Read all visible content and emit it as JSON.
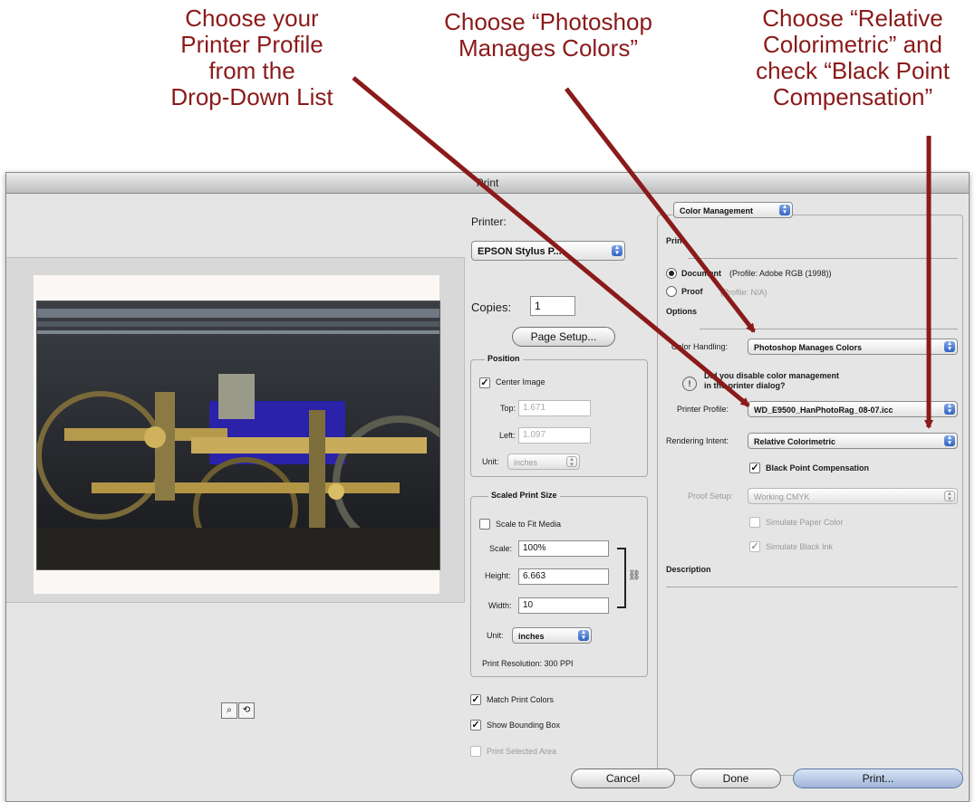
{
  "annotations": {
    "profile": [
      "Choose your",
      "Printer Profile",
      "from the",
      "Drop-Down List"
    ],
    "manages": [
      "Choose “Photoshop",
      "Manages Colors”"
    ],
    "intent": [
      "Choose “Relative",
      "Colorimetric” and",
      "check “Black Point",
      "Compensation”"
    ],
    "color": "#8b1a1a"
  },
  "dialog": {
    "title": "Print",
    "printer_label": "Printer:",
    "printer_value": "EPSON Stylus P...",
    "copies_label": "Copies:",
    "copies_value": "1",
    "page_setup_label": "Page Setup...",
    "position": {
      "title": "Position",
      "center_image": "Center Image",
      "top_label": "Top:",
      "top_value": "1.671",
      "left_label": "Left:",
      "left_value": "1.097",
      "unit_label": "Unit:",
      "unit_value": "inches"
    },
    "scaled": {
      "title": "Scaled Print Size",
      "scale_to_fit": "Scale to Fit Media",
      "scale_label": "Scale:",
      "scale_value": "100%",
      "height_label": "Height:",
      "height_value": "6.663",
      "width_label": "Width:",
      "width_value": "10",
      "unit_label": "Unit:",
      "unit_value": "inches",
      "resolution": "Print Resolution: 300 PPI"
    },
    "match_print_colors": "Match Print Colors",
    "show_bounding_box": "Show Bounding Box",
    "print_selected_area": "Print Selected Area",
    "color_management": {
      "popup": "Color Management",
      "print_label": "Print",
      "document_label": "Document",
      "document_profile": "(Profile: Adobe RGB (1998))",
      "proof_label": "Proof",
      "proof_profile": "(Profile: N/A)",
      "options_label": "Options",
      "color_handling_label": "Color Handling:",
      "color_handling_value": "Photoshop Manages Colors",
      "warning_text": [
        "Did you disable color management",
        "in the printer dialog?"
      ],
      "printer_profile_label": "Printer Profile:",
      "printer_profile_value": "WD_E9500_HanPhotoRag_08-07.icc",
      "rendering_intent_label": "Rendering Intent:",
      "rendering_intent_value": "Relative Colorimetric",
      "black_point": "Black Point Compensation",
      "proof_setup_label": "Proof Setup:",
      "proof_setup_value": "Working CMYK",
      "simulate_paper": "Simulate Paper Color",
      "simulate_black": "Simulate Black Ink",
      "description_label": "Description"
    },
    "buttons": {
      "cancel": "Cancel",
      "done": "Done",
      "print": "Print..."
    }
  }
}
